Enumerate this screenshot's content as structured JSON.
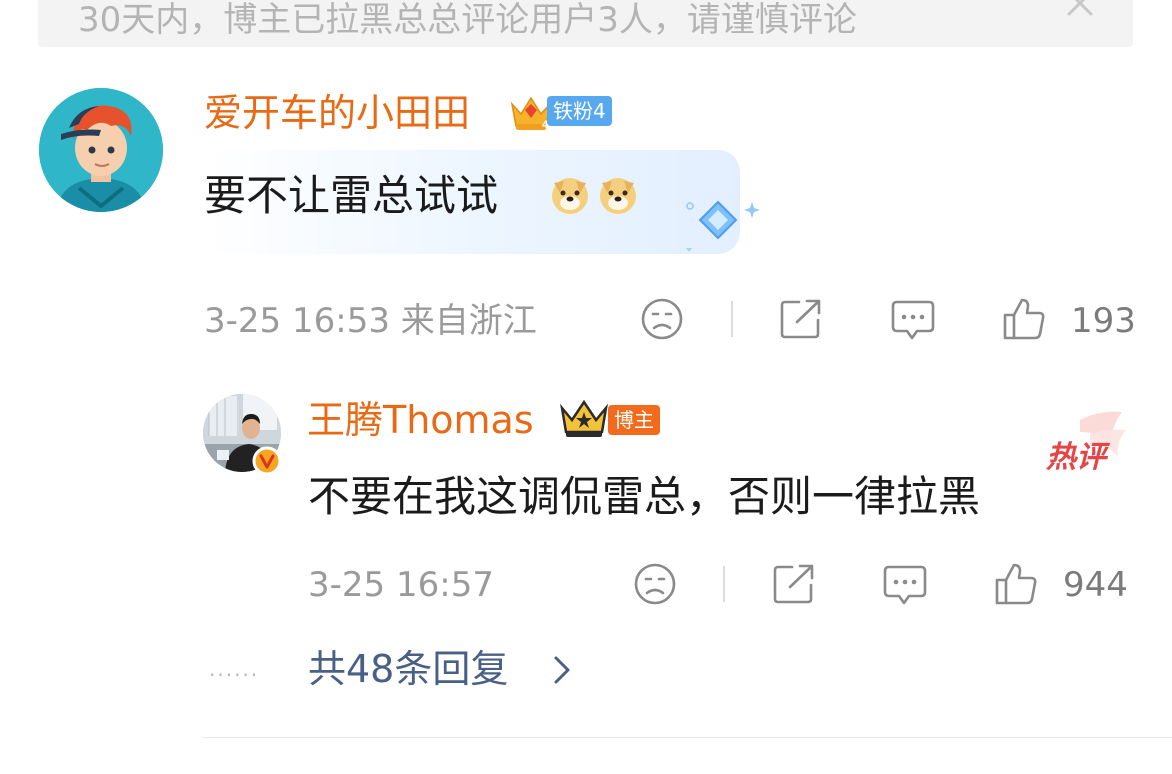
{
  "notice": {
    "text": "30天内，博主已拉黑总总评论用户3人，请谨慎评论"
  },
  "comment": {
    "username": "爱开车的小田田",
    "fan_badge": "铁粉4",
    "text": "要不让雷总试试",
    "emojis": [
      "doge",
      "doge"
    ],
    "meta": "3-25 16:53 来自浙江",
    "like_count": "193"
  },
  "reply": {
    "username": "王腾Thomas",
    "role_badge": "博主",
    "hot_label": "热评",
    "text": "不要在我这调侃雷总，否则一律拉黑",
    "meta": "3-25 16:57",
    "like_count": "944"
  },
  "more_replies": {
    "dots": "......",
    "label": "共48条回复"
  },
  "colors": {
    "username": "#e86a15",
    "link": "#485f86",
    "fan_badge": "#58a8f0",
    "blogger_badge": "#f26a1b",
    "hot": "#e64545"
  }
}
